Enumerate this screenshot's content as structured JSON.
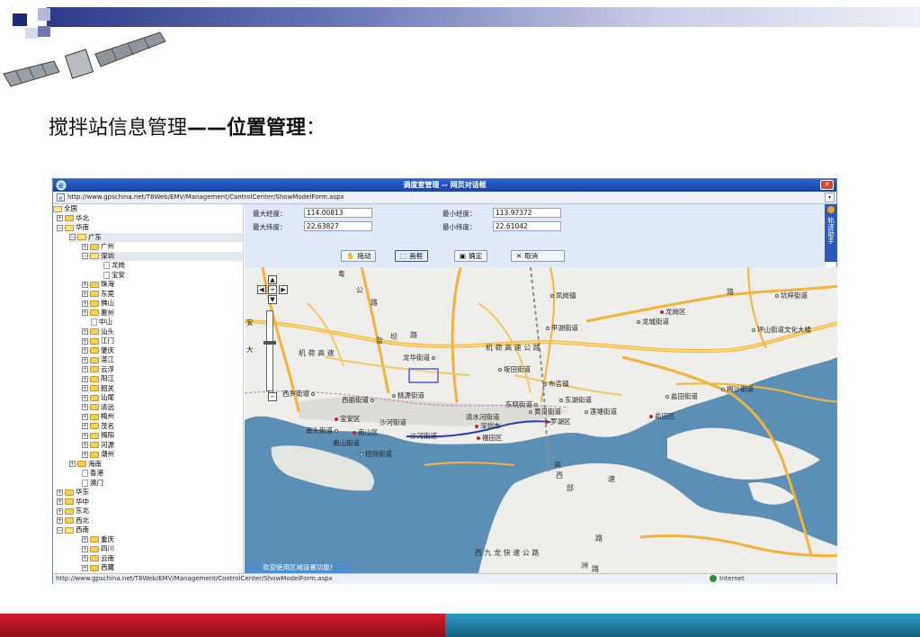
{
  "slide": {
    "title_normal": "搅拌站信息管理",
    "title_dash": "——",
    "title_bold": "位置管理",
    "title_colon": "："
  },
  "window": {
    "title": "调度室管理 -- 网页对话框",
    "close_glyph": "✕",
    "url": "http://www.gpschina.net/T8Web/EMV/Management/ControlCenter/ShowModelForm.aspx"
  },
  "tree": {
    "rows": [
      {
        "label": "全国",
        "type": "open-folder"
      },
      {
        "label": "华北",
        "type": "folder",
        "toggle": "+"
      },
      {
        "label": "华南",
        "type": "open-folder",
        "toggle": "−"
      },
      {
        "label": "广东",
        "type": "open-folder",
        "toggle": "−"
      },
      {
        "label": "广州",
        "type": "folder",
        "toggle": "+"
      },
      {
        "label": "深圳",
        "type": "open-folder",
        "toggle": "−"
      },
      {
        "label": "龙岗",
        "type": "leaf"
      },
      {
        "label": "宝安",
        "type": "leaf"
      },
      {
        "label": "珠海",
        "type": "folder",
        "toggle": "+"
      },
      {
        "label": "东莞",
        "type": "folder",
        "toggle": "+"
      },
      {
        "label": "佛山",
        "type": "folder",
        "toggle": "+"
      },
      {
        "label": "惠州",
        "type": "folder",
        "toggle": "+"
      },
      {
        "label": "中山",
        "type": "leaf"
      },
      {
        "label": "汕头",
        "type": "folder",
        "toggle": "+"
      },
      {
        "label": "江门",
        "type": "folder",
        "toggle": "+"
      },
      {
        "label": "肇庆",
        "type": "folder",
        "toggle": "+"
      },
      {
        "label": "湛江",
        "type": "folder",
        "toggle": "+"
      },
      {
        "label": "云浮",
        "type": "folder",
        "toggle": "+"
      },
      {
        "label": "阳江",
        "type": "folder",
        "toggle": "+"
      },
      {
        "label": "韶关",
        "type": "folder",
        "toggle": "+"
      },
      {
        "label": "汕尾",
        "type": "folder",
        "toggle": "+"
      },
      {
        "label": "清远",
        "type": "folder",
        "toggle": "+"
      },
      {
        "label": "梅州",
        "type": "folder",
        "toggle": "+"
      },
      {
        "label": "茂名",
        "type": "folder",
        "toggle": "+"
      },
      {
        "label": "揭阳",
        "type": "folder",
        "toggle": "+"
      },
      {
        "label": "河源",
        "type": "folder",
        "toggle": "+"
      },
      {
        "label": "潮州",
        "type": "folder",
        "toggle": "+"
      },
      {
        "label": "海南",
        "type": "folder",
        "toggle": "+"
      },
      {
        "label": "香港",
        "type": "leaf"
      },
      {
        "label": "澳门",
        "type": "leaf"
      },
      {
        "label": "华东",
        "type": "folder",
        "toggle": "+"
      },
      {
        "label": "华中",
        "type": "folder",
        "toggle": "+"
      },
      {
        "label": "东北",
        "type": "folder",
        "toggle": "+"
      },
      {
        "label": "西北",
        "type": "folder",
        "toggle": "+"
      },
      {
        "label": "西南",
        "type": "open-folder",
        "toggle": "−"
      },
      {
        "label": "重庆",
        "type": "folder",
        "toggle": "+"
      },
      {
        "label": "四川",
        "type": "folder",
        "toggle": "+"
      },
      {
        "label": "云南",
        "type": "folder",
        "toggle": "+"
      },
      {
        "label": "西藏",
        "type": "folder",
        "toggle": "+"
      }
    ]
  },
  "coords": {
    "max_lng_label": "最大经度：",
    "max_lng": "114.00813",
    "min_lng_label": "最小经度：",
    "min_lng": "113.97372",
    "max_lat_label": "最大纬度：",
    "max_lat": "22.63827",
    "min_lat_label": "最小纬度：",
    "min_lat": "22.61042"
  },
  "toolbar": {
    "drag_glyph": "✋",
    "drag_label": "拖动",
    "box_glyph": "⬚",
    "box_label": "画框",
    "ok_glyph": "▣",
    "ok_label": "确定",
    "cancel_glyph": "✕",
    "cancel_label": "取消"
  },
  "nav_helper": {
    "label": "轨迹助手"
  },
  "map": {
    "controls": {
      "up": "▲",
      "left": "◀",
      "right": "▶",
      "down": "▼",
      "zoom_in": "+",
      "zoom_out": "−"
    },
    "labels": {
      "fenggang": "凤岗镇",
      "longgang_district": "龙岗区",
      "longcheng": "龙城街道",
      "pinghu": "平湖街道",
      "pingshan": "坪山街道文化大楼",
      "kengzi": "坑梓街道",
      "longhua": "龙华街道",
      "bantian": "坂田街道",
      "buji": "布吉镇",
      "xixiang": "西乡街道",
      "xili": "西丽街道",
      "taoyuan": "桃源街道",
      "dongxiao": "东晓街道",
      "dongmen": "东湖街道",
      "huangbei": "黄贝街道",
      "liantang": "莲塘街道",
      "luohu": "罗湖区",
      "yantian_street": "盐田街道",
      "meisha": "梅沙街道",
      "yantian": "盐田区",
      "baoan": "宝安区",
      "shahe": "沙河街道",
      "qingshuihe": "清水河街道",
      "shenzhen": "深圳市",
      "nanshan": "南山区",
      "nantou": "南头街道",
      "nanshan_street": "南山街道",
      "shahe2": "沙河街道",
      "futian": "福田区",
      "shekou": "招商街道",
      "yue": "粤",
      "an": "安",
      "da": "大"
    },
    "highways": {
      "jihe": "机  荷  高  速",
      "jihe2": "机  荷  高  速  公  路",
      "gong": "公",
      "lu": "路",
      "lu2": "路",
      "lu3": "路",
      "yan": "盐",
      "ba": "坝",
      "gao": "高",
      "su": "速",
      "xi": "西",
      "bu": "部",
      "lu4": "路",
      "xiche": "西  九  龙  快  速  公  路",
      "gong2": "公",
      "zhu": "洲",
      "lu5": "路"
    },
    "welcome": "欢迎使用区域设置功能!"
  },
  "status": {
    "url": "http://www.gpschina.net/T8Web/EMV/Management/ControlCenter/ShowModelForm.aspx",
    "zone": "Internet"
  }
}
